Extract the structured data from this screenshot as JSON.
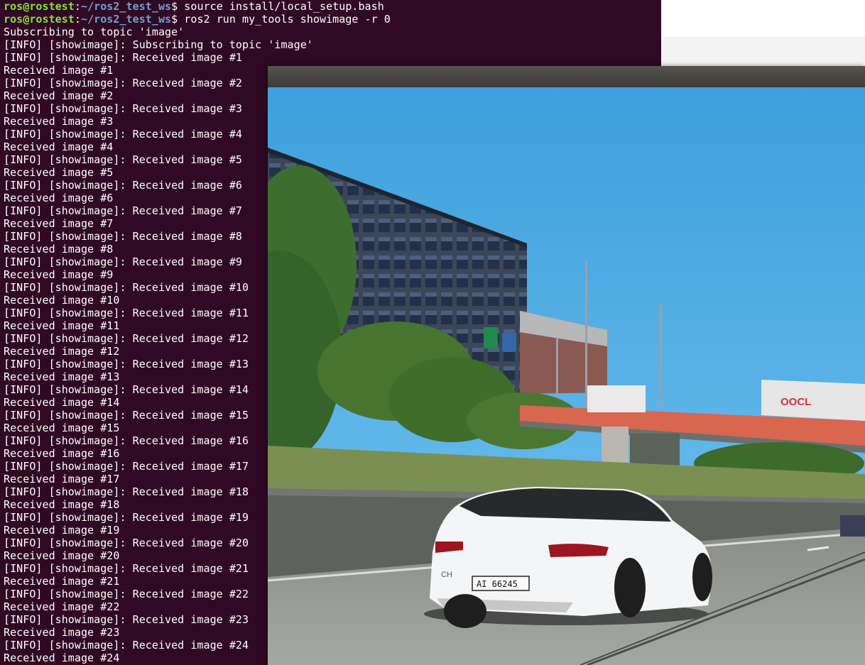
{
  "terminal": {
    "prompt_user": "ros@rostest",
    "prompt_path": "~/ros2_test_ws",
    "commands": [
      "source install/local_setup.bash",
      "ros2 run my_tools showimage -r 0"
    ],
    "output_lines": [
      "Subscribing to topic 'image'",
      "[INFO] [showimage]: Subscribing to topic 'image'",
      "[INFO] [showimage]: Received image #1",
      "Received image #1",
      "[INFO] [showimage]: Received image #2",
      "Received image #2",
      "[INFO] [showimage]: Received image #3",
      "Received image #3",
      "[INFO] [showimage]: Received image #4",
      "Received image #4",
      "[INFO] [showimage]: Received image #5",
      "Received image #5",
      "[INFO] [showimage]: Received image #6",
      "Received image #6",
      "[INFO] [showimage]: Received image #7",
      "Received image #7",
      "[INFO] [showimage]: Received image #8",
      "Received image #8",
      "[INFO] [showimage]: Received image #9",
      "Received image #9",
      "[INFO] [showimage]: Received image #10",
      "Received image #10",
      "[INFO] [showimage]: Received image #11",
      "Received image #11",
      "[INFO] [showimage]: Received image #12",
      "Received image #12",
      "[INFO] [showimage]: Received image #13",
      "Received image #13",
      "[INFO] [showimage]: Received image #14",
      "Received image #14",
      "[INFO] [showimage]: Received image #15",
      "Received image #15",
      "[INFO] [showimage]: Received image #16",
      "Received image #16",
      "[INFO] [showimage]: Received image #17",
      "Received image #17",
      "[INFO] [showimage]: Received image #18",
      "Received image #18",
      "[INFO] [showimage]: Received image #19",
      "Received image #19",
      "[INFO] [showimage]: Received image #20",
      "Received image #20",
      "[INFO] [showimage]: Received image #21",
      "Received image #21",
      "[INFO] [showimage]: Received image #22",
      "Received image #22",
      "[INFO] [showimage]: Received image #23",
      "Received image #23",
      "[INFO] [showimage]: Received image #24",
      "Received image #24"
    ]
  },
  "viewer": {
    "image": {
      "truck_logo": "OOCL",
      "plate_country": "CH",
      "plate_text": "AI 66245"
    }
  },
  "colors": {
    "terminal_bg": "#300a24",
    "prompt_user": "#8ae234",
    "prompt_path": "#729fcf",
    "text": "#ffffff",
    "sky": "#4ba8de"
  }
}
